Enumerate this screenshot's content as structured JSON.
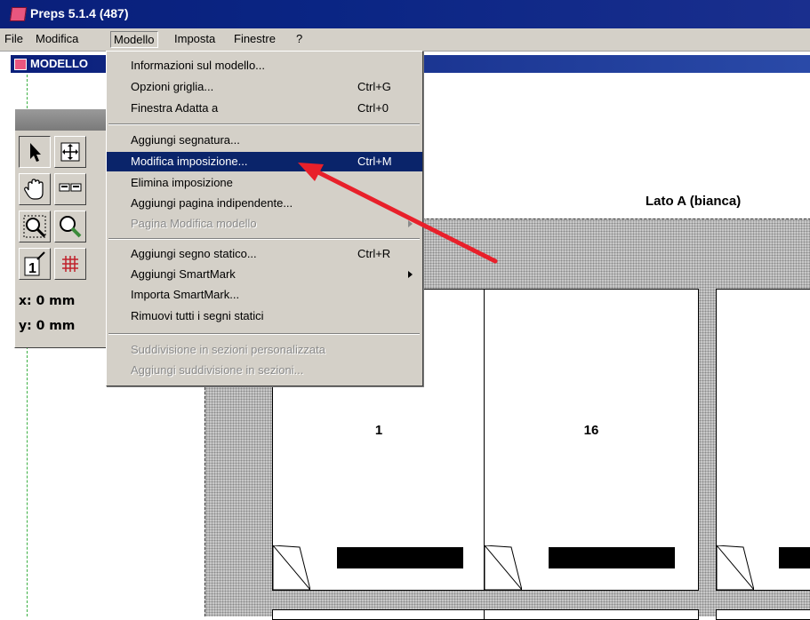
{
  "window": {
    "title": "Preps 5.1.4 (487)"
  },
  "menubar": {
    "items": [
      {
        "label": "File"
      },
      {
        "label": "Modifica"
      },
      {
        "label": "Modello"
      },
      {
        "label": "Imposta"
      },
      {
        "label": "Finestre"
      },
      {
        "label": "?"
      }
    ]
  },
  "document": {
    "title": "MODELLO"
  },
  "palette": {
    "x_readout": "x: 0 mm",
    "y_readout": "y: 0 mm",
    "page_tool_label": "1"
  },
  "modello_menu": {
    "items": [
      {
        "label": "Informazioni sul modello...",
        "shortcut": ""
      },
      {
        "label": "Opzioni griglia...",
        "shortcut": "Ctrl+G"
      },
      {
        "label": "Finestra Adatta a",
        "shortcut": "Ctrl+0"
      },
      {
        "label": "Aggiungi segnatura...",
        "shortcut": ""
      },
      {
        "label": "Modifica imposizione...",
        "shortcut": "Ctrl+M",
        "highlighted": true
      },
      {
        "label": "Elimina imposizione",
        "shortcut": ""
      },
      {
        "label": "Aggiungi pagina indipendente...",
        "shortcut": ""
      },
      {
        "label": "Pagina Modifica modello",
        "shortcut": "",
        "disabled": true,
        "submenu": true
      },
      {
        "label": "Aggiungi segno statico...",
        "shortcut": "Ctrl+R"
      },
      {
        "label": "Aggiungi SmartMark",
        "shortcut": "",
        "submenu": true
      },
      {
        "label": "Importa SmartMark...",
        "shortcut": ""
      },
      {
        "label": "Rimuovi tutti i segni statici",
        "shortcut": ""
      },
      {
        "label": "Suddivisione in sezioni personalizzata",
        "shortcut": "",
        "disabled": true
      },
      {
        "label": "Aggiungi suddivisione in sezioni...",
        "shortcut": "",
        "disabled": true
      }
    ]
  },
  "canvas": {
    "side_label": "Lato A (bianca)",
    "pages": [
      {
        "number": "1"
      },
      {
        "number": "16"
      },
      {
        "number": ""
      }
    ]
  },
  "colors": {
    "title_bar": "#0a246a",
    "menu_bg": "#d4d0c8",
    "highlight": "#0a246a",
    "annotation_arrow": "#e8202a"
  }
}
